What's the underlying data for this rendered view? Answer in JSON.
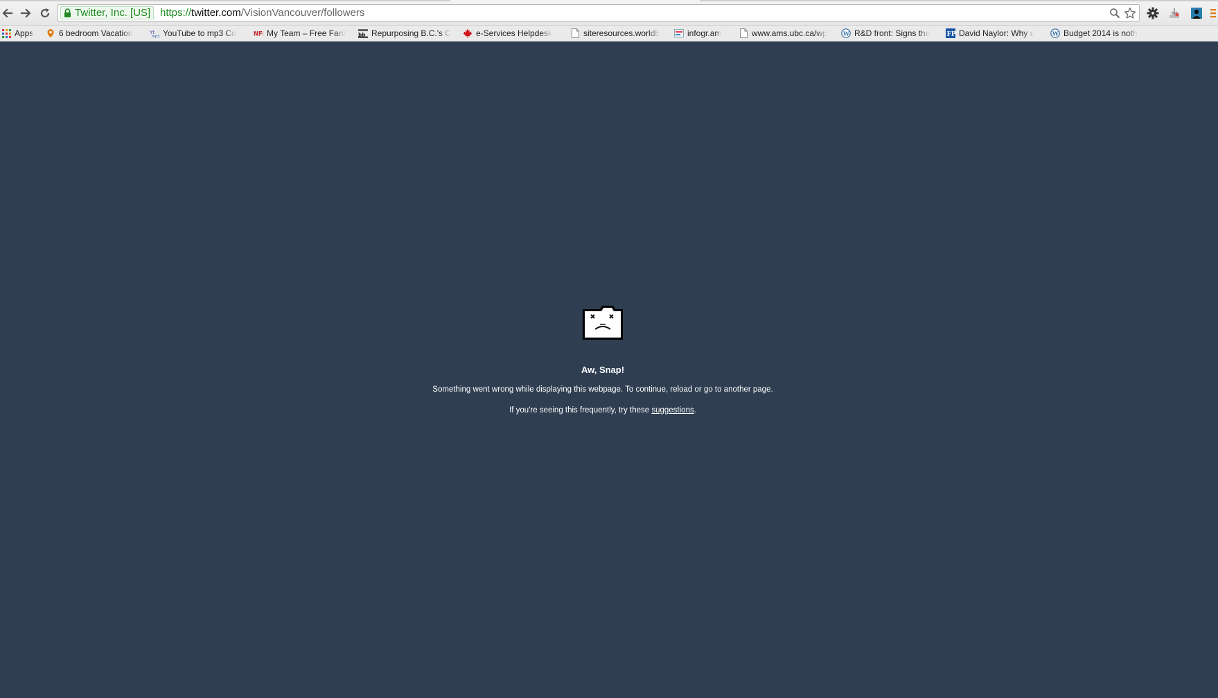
{
  "browser": {
    "ev_certificate": "Twitter, Inc. [US]",
    "url": {
      "scheme": "https://",
      "host": "twitter.com",
      "path": "/VisionVancouver/followers"
    }
  },
  "bookmarks": [
    {
      "label": "Apps",
      "icon": "apps-grid-icon"
    },
    {
      "label": "6 bedroom Vacation",
      "icon": "location-pin-icon"
    },
    {
      "label": "YouTube to mp3 Co",
      "icon": "mp3-icon"
    },
    {
      "label": "My Team – Free Fant",
      "icon": "nfl-icon"
    },
    {
      "label": "Repurposing B.C.'s C",
      "icon": "newspaper-icon"
    },
    {
      "label": "e-Services Helpdesk",
      "icon": "maple-leaf-icon"
    },
    {
      "label": "siteresources.worldb",
      "icon": "page-icon"
    },
    {
      "label": "infogr.am",
      "icon": "infogram-icon"
    },
    {
      "label": "www.ams.ubc.ca/wp",
      "icon": "page-icon"
    },
    {
      "label": "R&D front: Signs tha",
      "icon": "wordpress-icon"
    },
    {
      "label": "David Naylor: Why u",
      "icon": "fp-icon"
    },
    {
      "label": "Budget 2014 is noth",
      "icon": "wordpress-icon"
    }
  ],
  "sad_tab": {
    "title": "Aw, Snap!",
    "message": "Something went wrong while displaying this webpage. To continue, reload or go to another page.",
    "help_prefix": "If you're seeing this frequently, try these ",
    "help_link": "suggestions",
    "help_suffix": "."
  },
  "colors": {
    "page_background": "#2f3e51",
    "ev_green": "#1e8a1e"
  }
}
